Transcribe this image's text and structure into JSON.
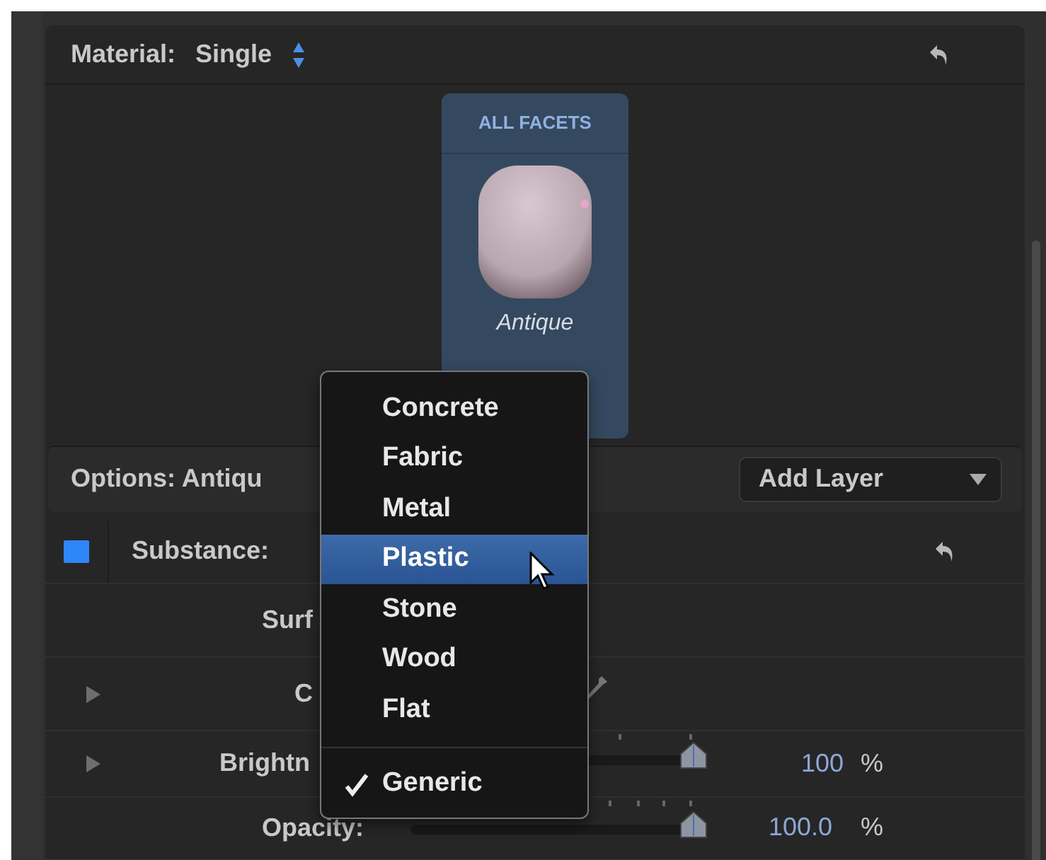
{
  "material": {
    "label": "Material:",
    "value": "Single"
  },
  "facet_card": {
    "title": "ALL FACETS",
    "name": "Antique"
  },
  "options": {
    "label": "Options: Antiqu",
    "button": "Add Layer"
  },
  "substance": {
    "label": "Substance:",
    "checked": true
  },
  "rows": [
    {
      "kind": "label",
      "label": "Surf"
    },
    {
      "kind": "color",
      "label": "C",
      "expanded": false
    },
    {
      "kind": "slider",
      "label": "Brightn",
      "expanded": false,
      "level": 1,
      "value": "100",
      "unit": "%"
    },
    {
      "kind": "slider",
      "label": "Opacity:",
      "level": 1,
      "value": "100.0",
      "unit": "%"
    }
  ],
  "menu": {
    "groups": [
      [
        {
          "label": "Concrete",
          "selected": false,
          "checked": false
        },
        {
          "label": "Fabric",
          "selected": false,
          "checked": false
        },
        {
          "label": "Metal",
          "selected": false,
          "checked": false
        },
        {
          "label": "Plastic",
          "selected": true,
          "checked": false
        },
        {
          "label": "Stone",
          "selected": false,
          "checked": false
        },
        {
          "label": "Wood",
          "selected": false,
          "checked": false
        },
        {
          "label": "Flat",
          "selected": false,
          "checked": false
        }
      ],
      [
        {
          "label": "Generic",
          "selected": false,
          "checked": true
        }
      ]
    ]
  }
}
